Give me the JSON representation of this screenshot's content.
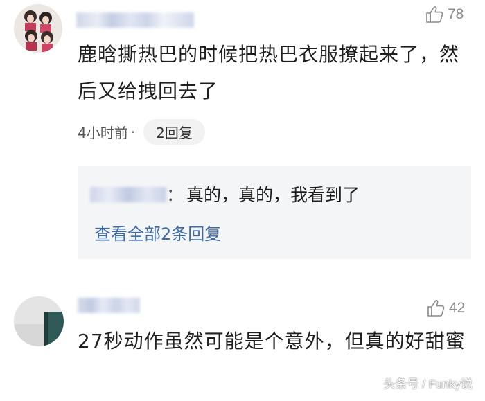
{
  "comments": [
    {
      "likes": "78",
      "text": "鹿晗撕热巴的时候把热巴衣服撩起来了，然后又给拽回去了",
      "time": "4小时前",
      "separator": "·",
      "reply_count_label": "2回复",
      "reply_preview": {
        "colon": "：",
        "text": "真的，真的，我看到了"
      },
      "view_all_label": "查看全部2条回复"
    },
    {
      "likes": "42",
      "text": "27秒动作虽然可能是个意外，但真的好甜蜜"
    }
  ],
  "watermark": "头条号 / Funky说",
  "colors": {
    "link": "#3e6aa3",
    "like_gray": "#8a8a8a",
    "reply_bg": "#f4f5f7"
  },
  "icons": {
    "like": "thumbs-up-icon"
  }
}
